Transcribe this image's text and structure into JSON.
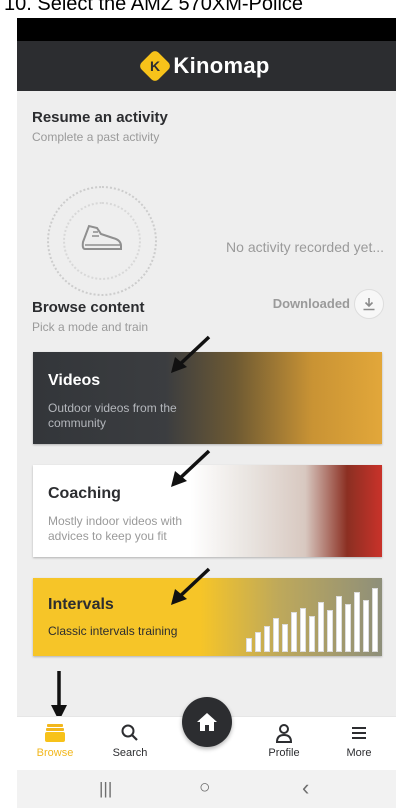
{
  "caption": {
    "text": "10. Select the AMZ 570XM-Police"
  },
  "header": {
    "logo_letter": "K",
    "app_name": "Kinomap"
  },
  "resume": {
    "title": "Resume an activity",
    "subtitle": "Complete a past activity",
    "empty_message": "No activity recorded yet..."
  },
  "browse": {
    "title": "Browse content",
    "subtitle": "Pick a mode and train",
    "downloaded_label": "Downloaded"
  },
  "cards": [
    {
      "title": "Videos",
      "description": "Outdoor videos from the community"
    },
    {
      "title": "Coaching",
      "description": "Mostly indoor videos with advices to keep you fit"
    },
    {
      "title": "Intervals",
      "description": "Classic intervals training"
    }
  ],
  "bottom_nav": {
    "items": [
      {
        "label": "Browse",
        "icon": "browse-icon",
        "active": true
      },
      {
        "label": "Search",
        "icon": "search-icon",
        "active": false
      },
      {
        "label": "",
        "icon": "home-icon",
        "active": false
      },
      {
        "label": "Profile",
        "icon": "person-icon",
        "active": false
      },
      {
        "label": "More",
        "icon": "menu-icon",
        "active": false
      }
    ]
  },
  "system_nav": {
    "recents": "|||",
    "home": "○",
    "back": "‹"
  },
  "colors": {
    "accent": "#f2b71c",
    "dark": "#2c2d30",
    "background": "#eeeeee",
    "intervals_card": "#f6c528"
  }
}
